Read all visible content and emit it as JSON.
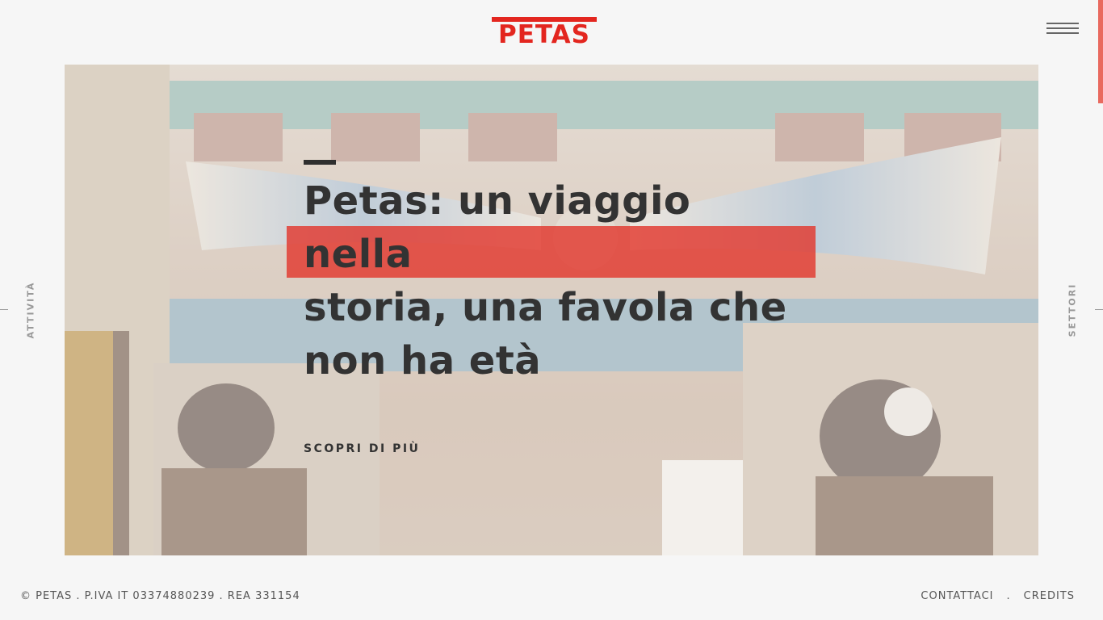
{
  "header": {
    "logo_text": "PETAS"
  },
  "hero": {
    "headline_lines": [
      "Petas: un viaggio",
      "nella",
      "storia, una favola che",
      "non ha età"
    ],
    "cta_label": "SCOPRI DI PIÙ"
  },
  "side_nav": {
    "left_label": "ATTIVITÀ",
    "right_label": "SETTORI"
  },
  "footer": {
    "legal": "© PETAS . P.IVA IT 03374880239 . REA 331154",
    "links": [
      "CONTATTACI",
      "CREDITS"
    ],
    "separator": "."
  },
  "colors": {
    "brand_red": "#e3261f",
    "highlight": "#e2382e",
    "background": "#f6f6f6"
  },
  "icons": [
    "menu-icon"
  ]
}
